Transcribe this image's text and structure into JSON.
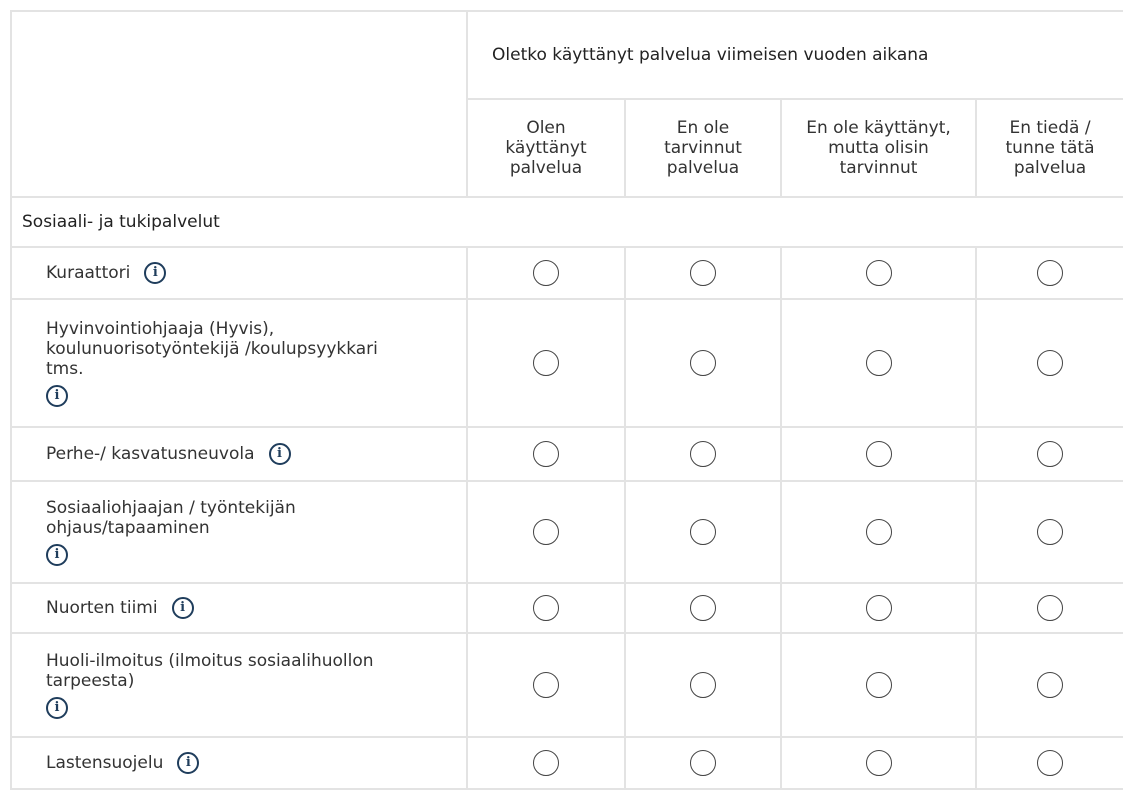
{
  "question_header": "Oletko käyttänyt palvelua viimeisen vuoden aikana",
  "options": [
    {
      "label": "Olen\nkäyttänyt\npalvelua"
    },
    {
      "label": "En ole\ntarvinnut\npalvelua"
    },
    {
      "label": "En ole käyttänyt,\nmutta olisin\ntarvinnut"
    },
    {
      "label": "En tiedä /\ntunne tätä\npalvelua"
    }
  ],
  "section": {
    "title": "Sosiaali- ja tukipalvelut"
  },
  "rows": [
    {
      "label": "Kuraattori",
      "info_icon": "info-icon"
    },
    {
      "label": "Hyvinvointiohjaaja (Hyvis),\nkoulunuorisotyöntekijä /koulupsyykkari\ntms.",
      "info_icon": "info-icon"
    },
    {
      "label": "Perhe-/ kasvatusneuvola",
      "info_icon": "info-icon"
    },
    {
      "label": "Sosiaaliohjaajan / työntekijän\nohjaus/tapaaminen",
      "info_icon": "info-icon"
    },
    {
      "label": "Nuorten tiimi",
      "info_icon": "info-icon"
    },
    {
      "label": "Huoli-ilmoitus (ilmoitus sosiaalihuollon\ntarpeesta)",
      "info_icon": "info-icon"
    },
    {
      "label": "Lastensuojelu",
      "info_icon": "info-icon"
    }
  ],
  "icons": {
    "info": "i"
  },
  "colors": {
    "info_icon": "#1f3d5c",
    "grid_line": "#e3e3e3",
    "radio_border": "#444444"
  }
}
